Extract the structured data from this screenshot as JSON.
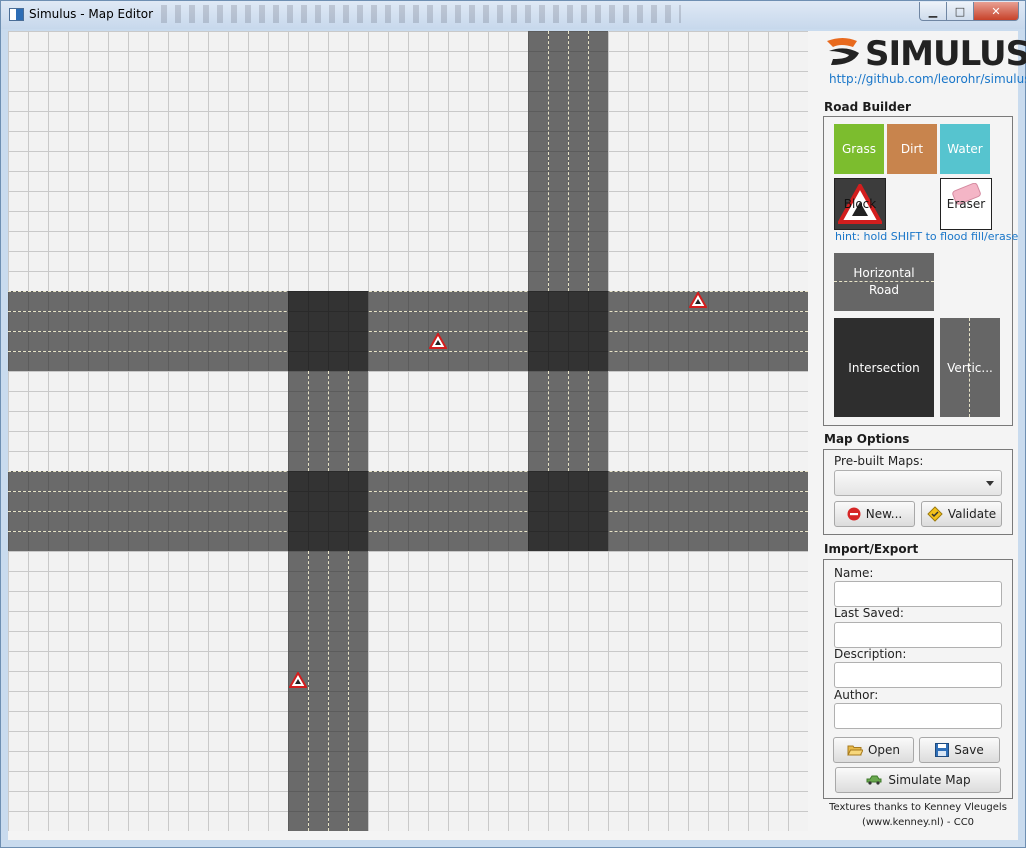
{
  "window": {
    "title": "Simulus - Map Editor",
    "minimize_glyph": "▁",
    "maximize_glyph": "□",
    "close_glyph": "✕"
  },
  "map": {
    "grid_size": 40,
    "hint_signs": 3
  },
  "sidebar": {
    "logo_text": "SIMULUS",
    "github_link": "http://github.com/leorohr/simulus",
    "road_builder": {
      "title": "Road Builder",
      "tiles": {
        "grass": "Grass",
        "dirt": "Dirt",
        "water": "Water",
        "block": "Block",
        "eraser": "Eraser",
        "horizontal_road_line1": "Horizontal",
        "horizontal_road_line2": "Road",
        "intersection": "Intersection",
        "vertical_road": "Vertic..."
      },
      "hint": "hint: hold SHIFT to flood fill/erase"
    },
    "map_options": {
      "title": "Map Options",
      "prebuilt_label": "Pre-built Maps:",
      "prebuilt_value": "",
      "new_button": "New...",
      "validate_button": "Validate"
    },
    "import_export": {
      "title": "Import/Export",
      "name_label": "Name:",
      "name_value": "",
      "last_saved_label": "Last Saved:",
      "last_saved_value": "",
      "description_label": "Description:",
      "description_value": "",
      "author_label": "Author:",
      "author_value": "",
      "open_button": "Open",
      "save_button": "Save",
      "simulate_button": "Simulate Map"
    },
    "credits_line1": "Textures thanks to Kenney Vleugels",
    "credits_line2": "(www.kenney.nl) - CC0"
  },
  "colors": {
    "grass": "#7cbd2e",
    "dirt": "#c8844d",
    "water": "#56c4cf",
    "road": "#6a6a6a",
    "intersection": "#333333",
    "accent_link": "#1976c9"
  }
}
